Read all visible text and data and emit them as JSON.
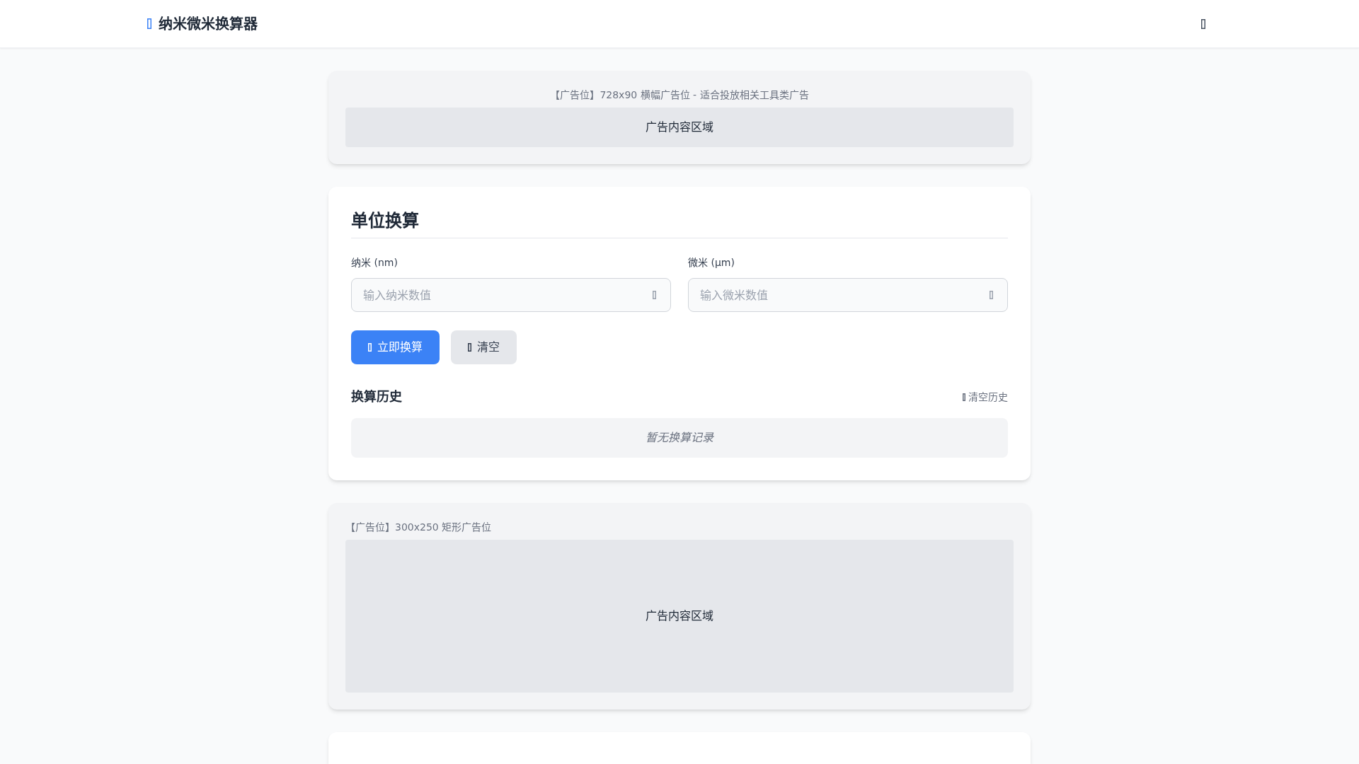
{
  "header": {
    "title": "纳米微米换算器"
  },
  "ad_banner": {
    "label": "【广告位】728x90 横幅广告位 - 适合投放相关工具类广告",
    "content": "广告内容区域"
  },
  "converter": {
    "title": "单位换算",
    "fields": [
      {
        "label": "纳米 (nm)",
        "placeholder": "输入纳米数值"
      },
      {
        "label": "微米 (μm)",
        "placeholder": "输入微米数值"
      }
    ],
    "buttons": [
      {
        "label": "立即换算",
        "kind": "primary"
      },
      {
        "label": "清空",
        "kind": "secondary"
      }
    ],
    "history": {
      "title": "换算历史",
      "clear_label": "清空历史",
      "empty_text": "暂无换算记录"
    }
  },
  "ad_rectangle": {
    "label": "【广告位】300x250 矩形广告位",
    "content": "广告内容区域"
  }
}
